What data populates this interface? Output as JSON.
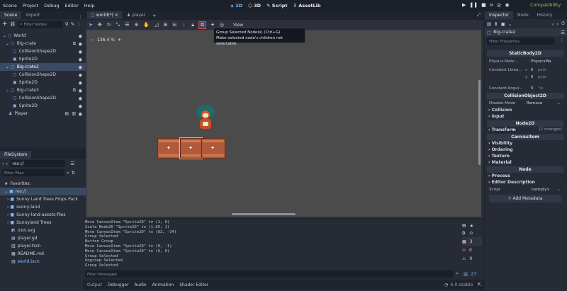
{
  "menu": {
    "items": [
      "Scene",
      "Project",
      "Debug",
      "Editor",
      "Help"
    ]
  },
  "workspaces": {
    "w2d": "2D",
    "w3d": "3D",
    "script": "Script",
    "assetlib": "AssetLib"
  },
  "renderer": "Compatibility",
  "scene_panel": {
    "tabs": [
      "Scene",
      "Import"
    ],
    "filter_placeholder": "Filter Nodes",
    "nodes": [
      {
        "label": "World",
        "indent": 0,
        "type": "node2d"
      },
      {
        "label": "Big-crate",
        "indent": 1,
        "type": "body"
      },
      {
        "label": "CollisionShape2D",
        "indent": 2,
        "type": "shape"
      },
      {
        "label": "Sprite2D",
        "indent": 2,
        "type": "sprite"
      },
      {
        "label": "Big-crate2",
        "indent": 1,
        "type": "body"
      },
      {
        "label": "CollisionShape2D",
        "indent": 2,
        "type": "shape"
      },
      {
        "label": "Sprite2D",
        "indent": 2,
        "type": "sprite"
      },
      {
        "label": "Big-crate3",
        "indent": 1,
        "type": "body"
      },
      {
        "label": "CollisionShape2D",
        "indent": 2,
        "type": "shape"
      },
      {
        "label": "Sprite2D",
        "indent": 2,
        "type": "sprite"
      },
      {
        "label": "Player",
        "indent": 1,
        "type": "player"
      }
    ]
  },
  "filesystem": {
    "tab": "FileSystem",
    "path": "res://",
    "filter_placeholder": "Filter Files",
    "favorites": "Favorites:",
    "items": [
      {
        "label": "res://",
        "kind": "root"
      },
      {
        "label": "Sunny Land Trees Props Pack",
        "kind": "folder"
      },
      {
        "label": "sunny-land",
        "kind": "folder"
      },
      {
        "label": "Sunny-land-assets-files",
        "kind": "folder"
      },
      {
        "label": "Sunnyland Trees",
        "kind": "folder"
      },
      {
        "label": "icon.svg",
        "kind": "svg"
      },
      {
        "label": "player.gd",
        "kind": "script"
      },
      {
        "label": "player.tscn",
        "kind": "scene"
      },
      {
        "label": "README.md",
        "kind": "text"
      },
      {
        "label": "world.tscn",
        "kind": "scene"
      }
    ]
  },
  "editor": {
    "tabs": [
      "world(*)",
      "player"
    ],
    "view_menu": "View",
    "zoom": "136.4 %",
    "tooltip": {
      "line1": "Group Selected Node(s) (Ctrl+G)",
      "line2": "Make selected node's children not selectable."
    }
  },
  "output": {
    "lines": [
      "Move CanvasItem \"Sprite2D\" to (1, 0)",
      "Scale Node2D \"Sprite2D\" to (1.69, 1)",
      "Move CanvasItem \"Sprite2D\" to (82, -34)",
      "Group Selected",
      "Button Group",
      "Move CanvasItem \"Sprite2D\" to (0, -1)",
      "Move CanvasItem \"Sprite2D\" to (0, 0)",
      "Group Selected",
      "Ungroup Selected",
      "Group Selected"
    ],
    "filter_placeholder": "Filter Messages",
    "counts": {
      "log": "3",
      "errors": "0",
      "warnings": "0",
      "messages": "27"
    },
    "bottom_tabs": [
      "Output",
      "Debugger",
      "Audio",
      "Animation",
      "Shader Editor"
    ],
    "version": "4.0.stable"
  },
  "inspector": {
    "tabs": [
      "Inspector",
      "Node",
      "History"
    ],
    "node_name": "Big-crate2",
    "filter_placeholder": "Filter Properties",
    "class_staticbody": "StaticBody2D",
    "physics_material_label": "Physics Mate...",
    "physics_material_value": "PhysicsMa",
    "constant_linear_label": "Constant Linea...",
    "constant_linear_x": "0",
    "constant_linear_y": "0",
    "constant_linear_unit": "px/s",
    "constant_angular_label": "Constant Angul...",
    "constant_angular_value": "0",
    "constant_angular_unit": "°/s",
    "class_collisionobject": "CollisionObject2D",
    "disable_mode_label": "Disable Mode",
    "disable_mode_value": "Remove",
    "group_collision": "Collision",
    "group_input": "Input",
    "class_node2d": "Node2D",
    "group_transform": "Transform",
    "transform_changes": "(2 changes)",
    "class_canvasitem": "CanvasItem",
    "group_visibility": "Visibility",
    "group_ordering": "Ordering",
    "group_texture": "Texture",
    "group_material": "Material",
    "class_node": "Node",
    "group_process": "Process",
    "group_editor_description": "Editor Description",
    "script_label": "Script",
    "script_value": "<empty>",
    "add_metadata": "Add Metadata"
  },
  "colors": {
    "accent": "#6cb6ff",
    "selection": "#3a4a63",
    "tooltip_highlight": "#e0413b",
    "viewport": "#4b4b4b"
  }
}
